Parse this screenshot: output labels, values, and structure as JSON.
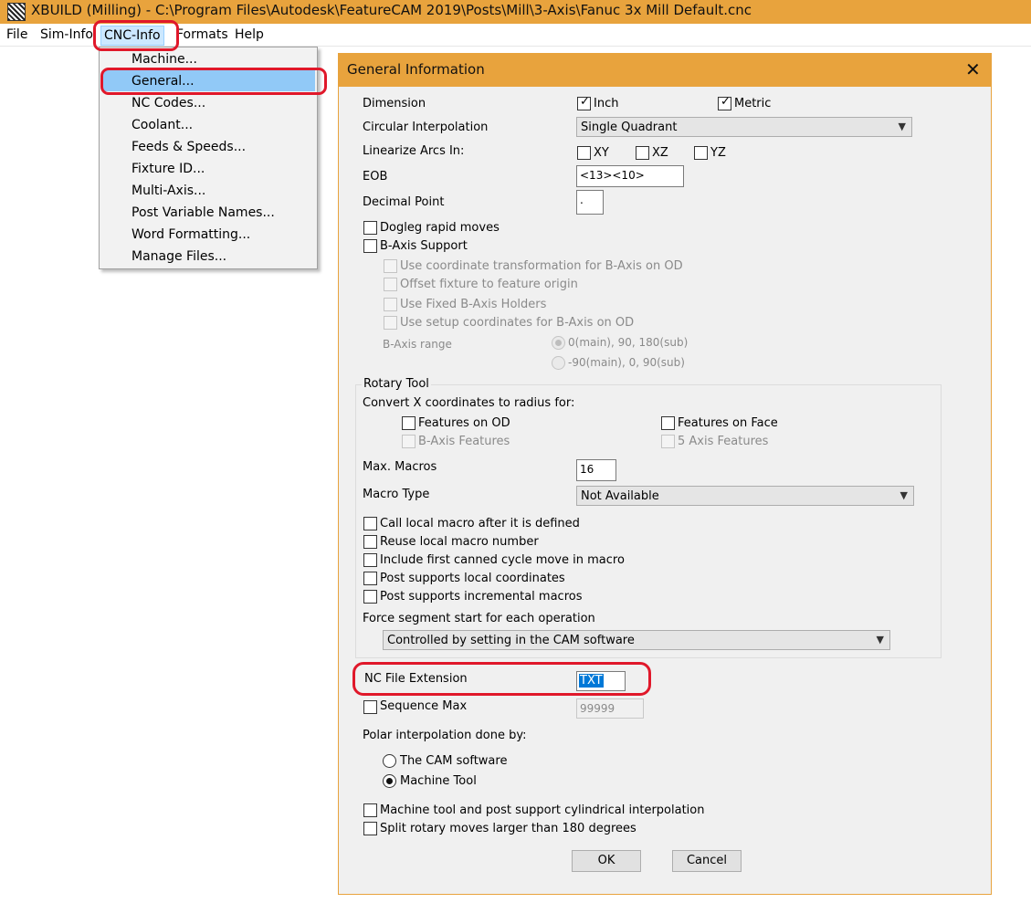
{
  "window": {
    "title": "XBUILD (Milling) - C:\\Program Files\\Autodesk\\FeatureCAM 2019\\Posts\\Mill\\3-Axis\\Fanuc 3x Mill Default.cnc",
    "accent": "#e8a33d"
  },
  "menubar": {
    "items": [
      "File",
      "Sim-Info",
      "CNC-Info",
      "Formats",
      "Help"
    ],
    "active": "CNC-Info"
  },
  "cnc_menu": {
    "items": [
      "Machine...",
      "General...",
      "NC Codes...",
      "Coolant...",
      "Feeds & Speeds...",
      "Fixture ID...",
      "Multi-Axis...",
      "Post Variable Names...",
      "Word Formatting...",
      "Manage Files..."
    ],
    "highlighted": "General..."
  },
  "dialog": {
    "title": "General Information",
    "close_glyph": "✕",
    "dimension": {
      "label": "Dimension",
      "inch": "Inch",
      "inch_checked": true,
      "metric": "Metric",
      "metric_checked": true
    },
    "circular_interpolation": {
      "label": "Circular Interpolation",
      "value": "Single Quadrant"
    },
    "linearize": {
      "label": "Linearize Arcs In:",
      "xy": "XY",
      "xz": "XZ",
      "yz": "YZ"
    },
    "eob": {
      "label": "EOB",
      "value": "<13><10>"
    },
    "decimal_point": {
      "label": "Decimal Point",
      "value": "."
    },
    "dogleg": "Dogleg rapid moves",
    "b_axis_support": "B-Axis Support",
    "b_axis_options": [
      "Use coordinate transformation for B-Axis on OD",
      "Offset fixture to feature origin",
      "Use Fixed B-Axis Holders",
      "Use setup coordinates for B-Axis on OD"
    ],
    "b_axis_range": {
      "label": "B-Axis range",
      "option1": "0(main), 90, 180(sub)",
      "option2": "-90(main), 0, 90(sub)"
    },
    "rotary_tool": {
      "title": "Rotary Tool",
      "convert_label": "Convert X coordinates to radius for:",
      "features_on_od": "Features on OD",
      "features_on_face": "Features on Face",
      "b_axis_features": "B-Axis Features",
      "five_axis_features": "5 Axis Features",
      "max_macros_label": "Max. Macros",
      "max_macros_value": "16",
      "macro_type_label": "Macro Type",
      "macro_type_value": "Not Available",
      "options": [
        "Call local macro after it is defined",
        "Reuse local macro number",
        "Include first canned cycle move in macro",
        "Post supports local coordinates",
        "Post supports incremental macros"
      ],
      "force_segment_label": "Force segment start for each operation",
      "force_segment_value": "Controlled by setting in the CAM software"
    },
    "nc_file_extension": {
      "label": "NC File Extension",
      "value": "TXT"
    },
    "sequence_max": {
      "label": "Sequence Max",
      "value": "99999"
    },
    "polar": {
      "label": "Polar interpolation done by:",
      "option1": "The CAM software",
      "option2": "Machine Tool",
      "selected": "Machine Tool"
    },
    "cylindrical": "Machine tool and post support cylindrical interpolation",
    "split_rotary": "Split rotary moves larger than 180 degrees",
    "ok": "OK",
    "cancel": "Cancel"
  },
  "annotation_color": "#e0182a"
}
